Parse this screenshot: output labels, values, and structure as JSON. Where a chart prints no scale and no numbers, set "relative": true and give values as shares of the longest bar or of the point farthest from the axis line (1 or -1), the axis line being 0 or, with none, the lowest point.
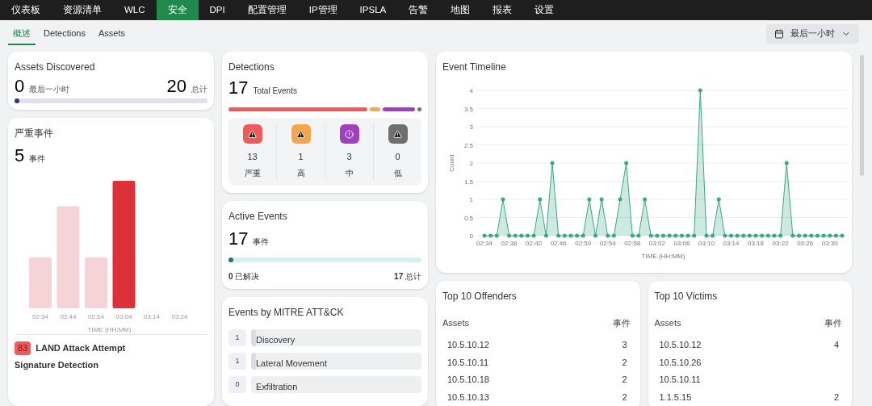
{
  "nav": [
    {
      "label": "仪表板",
      "selected": false
    },
    {
      "label": "资源清单",
      "selected": false
    },
    {
      "label": "WLC",
      "selected": false
    },
    {
      "label": "安全",
      "selected": true
    },
    {
      "label": "DPI",
      "selected": false
    },
    {
      "label": "配置管理",
      "selected": false
    },
    {
      "label": "IP管理",
      "selected": false
    },
    {
      "label": "IPSLA",
      "selected": false
    },
    {
      "label": "告警",
      "selected": false
    },
    {
      "label": "地图",
      "selected": false
    },
    {
      "label": "报表",
      "selected": false
    },
    {
      "label": "设置",
      "selected": false
    }
  ],
  "tabs": [
    {
      "label": "概述",
      "selected": true
    },
    {
      "label": "Detections",
      "selected": false
    },
    {
      "label": "Assets",
      "selected": false
    }
  ],
  "time_range": "最后一小时",
  "assets_discovered": {
    "title": "Assets Discovered",
    "recent": "0",
    "recent_label": "最后一小时",
    "total": "20",
    "total_label": "总计",
    "level": 0
  },
  "critical_events": {
    "title": "严重事件",
    "count": "5",
    "unit": "事件",
    "chart_data": {
      "type": "bar",
      "relative": true,
      "xlabel": "TIME (HH:MM)",
      "categories": [
        "02:34",
        "02:44",
        "02:54",
        "03:04",
        "03:14",
        "03:24"
      ],
      "stacked": true,
      "series": [
        {
          "color": "#f5d3d6",
          "values": [
            0.4,
            0.8,
            0.4,
            null,
            null,
            null
          ]
        },
        {
          "color": "#dc3138",
          "values": [
            null,
            null,
            null,
            1,
            null,
            null
          ]
        }
      ]
    },
    "latest": {
      "score": "83",
      "title": "LAND Attack Attempt",
      "subtitle": "Signature Detection"
    }
  },
  "detections": {
    "title": "Detections",
    "count": "17",
    "count_label": "Total Events",
    "severities": [
      {
        "kind": "triangle",
        "count": "13",
        "label": "严重",
        "color": "#f05a5a"
      },
      {
        "kind": "triangle",
        "count": "1",
        "label": "高",
        "color": "#f6a54a"
      },
      {
        "kind": "circle",
        "count": "3",
        "label": "中",
        "color": "#a23fc0"
      },
      {
        "kind": "triangle",
        "count": "0",
        "label": "低",
        "color": "#6e6e6e"
      }
    ]
  },
  "active_events": {
    "title": "Active Events",
    "count": "17",
    "unit": "事件",
    "level": 0,
    "resolved": "0",
    "resolved_label": "已解决",
    "total": "17",
    "total_label": "总计"
  },
  "mitre": {
    "title": "Events by MITRE ATT&CK",
    "items": [
      {
        "count": "1",
        "name": "Discovery",
        "level": 0.03
      },
      {
        "count": "1",
        "name": "Lateral Movement",
        "level": 0.03
      },
      {
        "count": "0",
        "name": "Exfiltration",
        "level": 0
      }
    ]
  },
  "timeline": {
    "title": "Event Timeline",
    "chart_data": {
      "type": "area",
      "xlabel": "TIME (HH:MM)",
      "ylabel": "Count",
      "categories": [
        "02:34",
        null,
        null,
        null,
        "02:38",
        null,
        null,
        null,
        "02:42",
        null,
        null,
        null,
        "02:46",
        null,
        null,
        null,
        "02:50",
        null,
        null,
        null,
        "02:54",
        null,
        null,
        null,
        "02:58",
        null,
        null,
        null,
        "03:02",
        null,
        null,
        null,
        "03:06",
        null,
        null,
        null,
        "03:10",
        null,
        null,
        null,
        "03:14",
        null,
        null,
        null,
        "03:18",
        null,
        null,
        null,
        "03:22",
        null,
        null,
        null,
        "03:26",
        null,
        null,
        null,
        "03:30",
        null,
        null
      ],
      "series": [
        {
          "color": "#3aa986",
          "values": [
            0,
            0,
            0,
            1,
            0,
            0,
            0,
            0,
            0,
            1,
            0,
            2,
            0,
            0,
            0,
            0,
            0,
            1,
            0,
            1,
            0,
            0,
            1,
            2,
            0,
            0,
            1,
            0,
            0,
            0,
            0,
            0,
            0,
            0,
            0,
            4,
            0,
            0,
            1,
            0,
            0,
            0,
            0,
            0,
            0,
            0,
            0,
            0,
            0,
            2,
            0,
            0,
            0,
            0,
            0,
            0,
            0,
            0,
            0
          ]
        }
      ],
      "ylim": [
        0,
        4
      ],
      "yticks": [
        0,
        0.5,
        1,
        1.5,
        2,
        2.5,
        3,
        3.5,
        4
      ],
      "grid": true
    }
  },
  "offenders": {
    "title": "Top 10 Offenders",
    "columns": [
      "Assets",
      "事件"
    ],
    "rows": [
      {
        "asset": "10.5.10.12",
        "events": "3"
      },
      {
        "asset": "10.5.10.11",
        "events": "2"
      },
      {
        "asset": "10.5.10.18",
        "events": "2"
      },
      {
        "asset": "10.5.10.13",
        "events": "2"
      }
    ]
  },
  "victims": {
    "title": "Top 10 Victims",
    "columns": [
      "Assets",
      "事件"
    ],
    "rows": [
      {
        "asset": "10.5.10.12",
        "events": "4"
      },
      {
        "asset": "10.5.10.26"
      },
      {
        "asset": "10.5.10.11"
      },
      {
        "asset": "1.1.5.15",
        "events": "2"
      }
    ]
  }
}
